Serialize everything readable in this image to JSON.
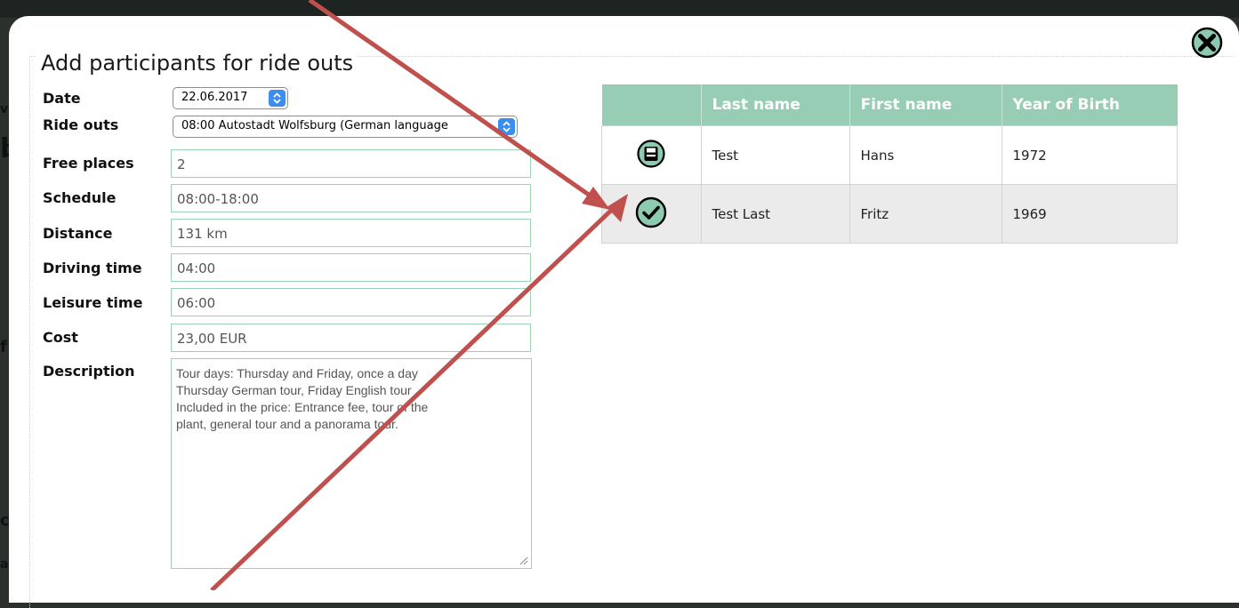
{
  "modal": {
    "title": "Add participants for ride outs",
    "close_icon": "close-circle-x-icon"
  },
  "form": {
    "date": {
      "label": "Date",
      "value": "22.06.2017"
    },
    "ride_outs": {
      "label": "Ride outs",
      "value": "08:00 Autostadt Wolfsburg (German language"
    },
    "free_places": {
      "label": "Free places",
      "value": "2"
    },
    "schedule": {
      "label": "Schedule",
      "value": "08:00-18:00"
    },
    "distance": {
      "label": "Distance",
      "value": "131 km"
    },
    "driving_time": {
      "label": "Driving time",
      "value": "04:00"
    },
    "leisure_time": {
      "label": "Leisure time",
      "value": "06:00"
    },
    "cost": {
      "label": "Cost",
      "value": "23,00 EUR"
    },
    "description": {
      "label": "Description",
      "lines": [
        "Tour days: Thursday and Friday, once a day",
        "Thursday German tour, Friday English tour",
        "Included in the price: Entrance fee, tour of the",
        "plant, general tour and a panorama tour."
      ]
    }
  },
  "participants": {
    "columns": [
      "",
      "Last name",
      "First name",
      "Year of Birth"
    ],
    "rows": [
      {
        "icon": "save-floppy-icon",
        "last_name": "Test",
        "first_name": "Hans",
        "year_of_birth": "1972"
      },
      {
        "icon": "checkmark-icon",
        "last_name": "Test Last",
        "first_name": "Fritz",
        "year_of_birth": "1969"
      }
    ]
  },
  "background": {
    "edge_letters": [
      "v",
      "b",
      "f",
      "c",
      "a"
    ]
  },
  "colors": {
    "accent_green": "#97cdb4",
    "field_border": "#9fd3b7",
    "annotation_arrow": "#c0504d",
    "select_arrow_blue": "#3b8ef0"
  }
}
